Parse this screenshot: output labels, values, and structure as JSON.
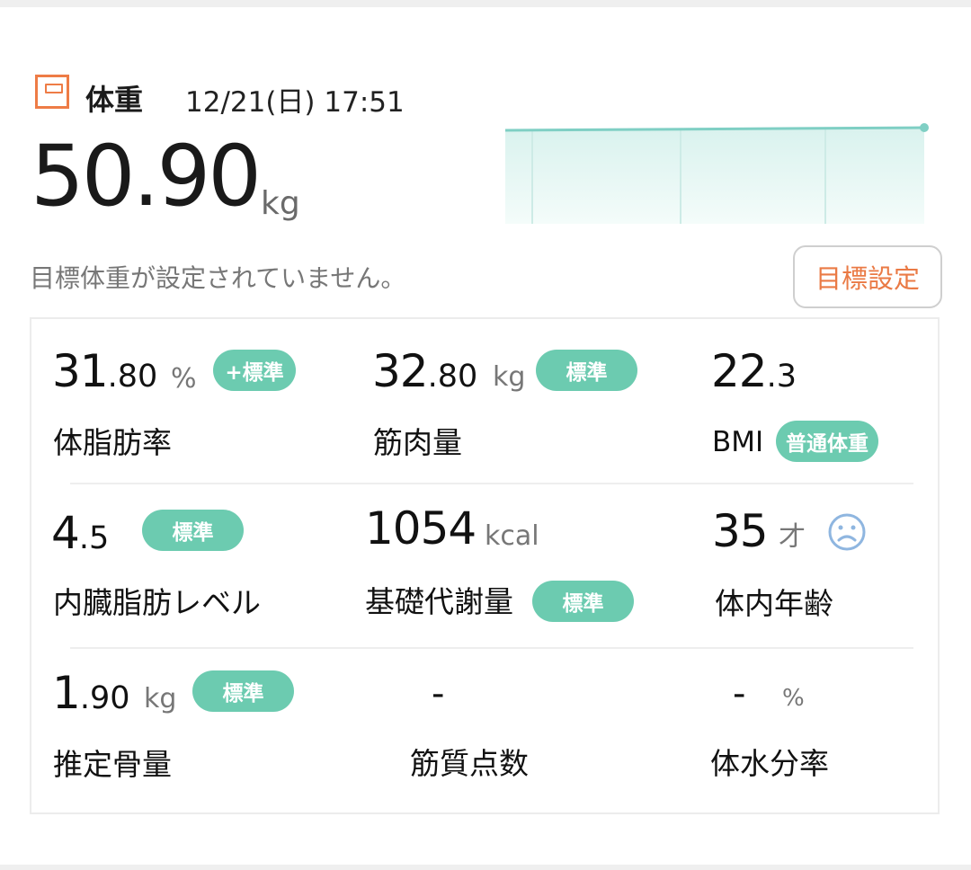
{
  "header": {
    "title": "体重",
    "datetime": "12/21(日) 17:51",
    "weight_value": "50.90",
    "weight_unit": "kg",
    "goal_message": "目標体重が設定されていません。",
    "goal_button": "目標設定"
  },
  "colors": {
    "accent": "#ea7a45",
    "badge": "#6ccbb0",
    "chart_line": "#7fcfc4",
    "chart_fill": "#e6f7f4"
  },
  "metrics": {
    "body_fat": {
      "int": "31",
      "dec": ".80",
      "unit": "%",
      "badge": "+標準",
      "label": "体脂肪率"
    },
    "muscle": {
      "int": "32",
      "dec": ".80",
      "unit": "kg",
      "badge": "標準",
      "label": "筋肉量"
    },
    "bmi": {
      "int": "22",
      "dec": ".3",
      "badge": "普通体重",
      "label": "BMI"
    },
    "visceral": {
      "int": "4",
      "dec": ".5",
      "badge": "標準",
      "label": "内臓脂肪レベル"
    },
    "bmr": {
      "int": "1054",
      "unit": "kcal",
      "badge": "標準",
      "label": "基礎代謝量"
    },
    "body_age": {
      "int": "35",
      "unit": "才",
      "icon": "sad-face-icon",
      "label": "体内年齢"
    },
    "bone": {
      "int": "1",
      "dec": ".90",
      "unit": "kg",
      "badge": "標準",
      "label": "推定骨量"
    },
    "muscle_score": {
      "value": "-",
      "label": "筋質点数"
    },
    "body_water": {
      "value": "-",
      "unit": "%",
      "label": "体水分率"
    }
  }
}
